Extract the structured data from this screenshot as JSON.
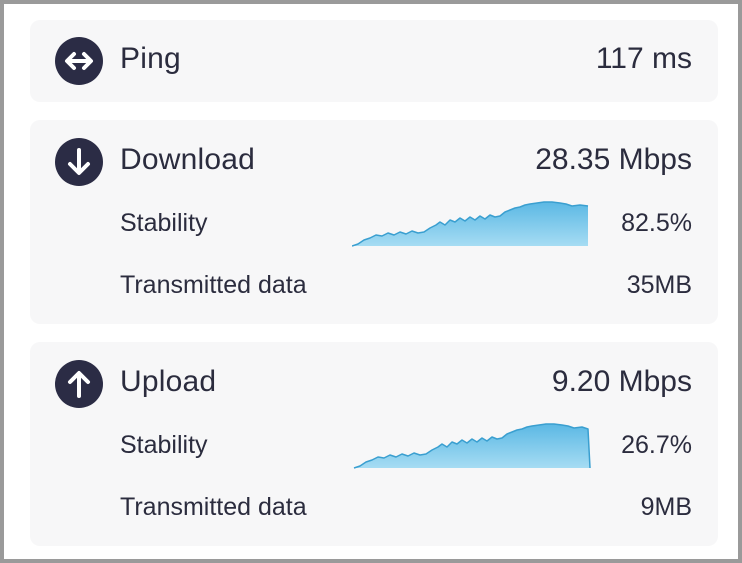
{
  "ping": {
    "title": "Ping",
    "value": "117 ms",
    "icon": "double-arrow-icon"
  },
  "download": {
    "title": "Download",
    "value": "28.35 Mbps",
    "icon": "arrow-down-icon",
    "stability_label": "Stability",
    "stability_value": "82.5%",
    "data_label": "Transmitted data",
    "data_value": "35MB"
  },
  "upload": {
    "title": "Upload",
    "value": "9.20 Mbps",
    "icon": "arrow-up-icon",
    "stability_label": "Stability",
    "stability_value": "26.7%",
    "data_label": "Transmitted data",
    "data_value": "9MB"
  },
  "colors": {
    "icon_bg": "#2b2c45",
    "text": "#2b2c3e",
    "card_bg": "#f7f7f8",
    "spark_top": "#5bb8e4",
    "spark_bottom": "#a6dcf3",
    "spark_line": "#3a9fd0"
  }
}
